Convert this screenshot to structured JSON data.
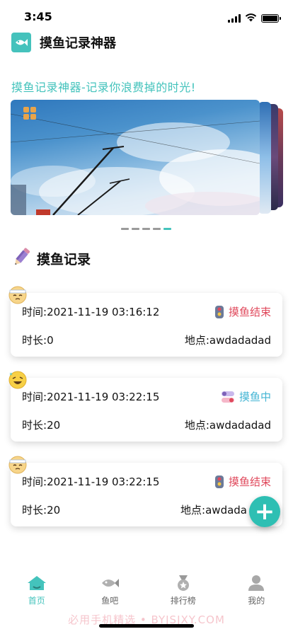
{
  "status_bar": {
    "time": "3:45"
  },
  "header": {
    "title": "摸鱼记录神器",
    "logo": "fish-logo-icon"
  },
  "slogan": "摸鱼记录神器-记录你浪费掉的时光!",
  "carousel": {
    "slide_count": 5,
    "active_index": 4
  },
  "section": {
    "title": "摸鱼记录",
    "icon": "pencil-icon"
  },
  "records": [
    {
      "time_label": "时间:",
      "time": "2021-11-19 03:16:12",
      "status": "摸鱼结束",
      "status_type": "ended",
      "duration_label": "时长:",
      "duration": "0",
      "location_label": "地点:",
      "location": "awdadadad"
    },
    {
      "time_label": "时间:",
      "time": "2021-11-19 03:22:15",
      "status": "摸鱼中",
      "status_type": "ongoing",
      "duration_label": "时长:",
      "duration": "20",
      "location_label": "地点:",
      "location": "awdadadad"
    },
    {
      "time_label": "时间:",
      "time": "2021-11-19 03:22:15",
      "status": "摸鱼结束",
      "status_type": "ended",
      "duration_label": "时长:",
      "duration": "20",
      "location_label": "地点:",
      "location": "awdada"
    }
  ],
  "tabbar": {
    "items": [
      {
        "label": "首页",
        "icon": "home-icon",
        "active": true
      },
      {
        "label": "鱼吧",
        "icon": "fish-icon",
        "active": false
      },
      {
        "label": "排行榜",
        "icon": "ranking-medal-icon",
        "active": false
      },
      {
        "label": "我的",
        "icon": "profile-icon",
        "active": false
      }
    ]
  },
  "watermark": "必用手机精选 • BYJSJXY.COM",
  "colors": {
    "accent": "#44c3bc",
    "ended": "#e0495c",
    "ongoing": "#44b5d4"
  }
}
